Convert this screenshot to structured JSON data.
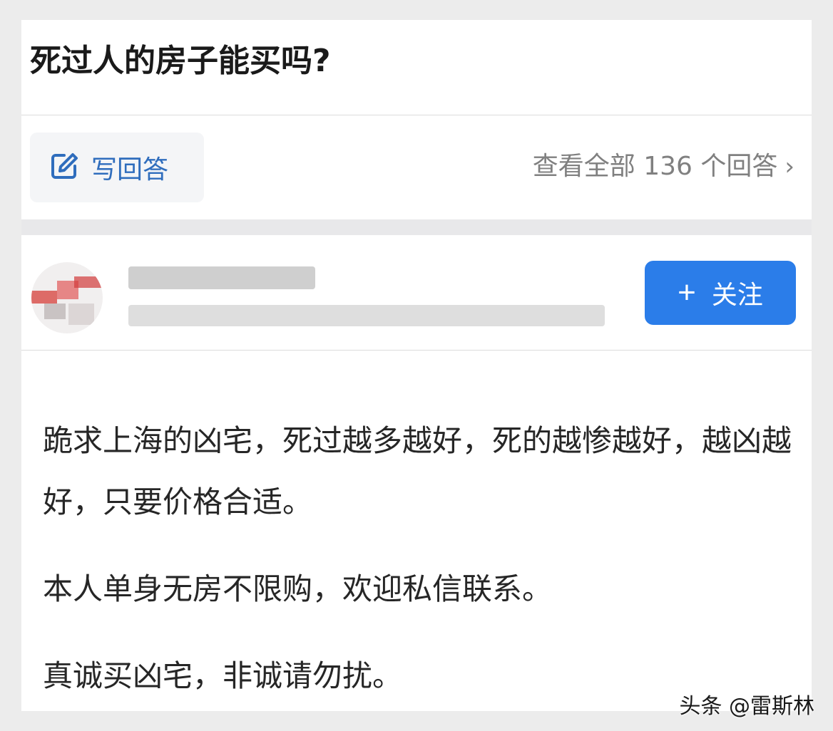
{
  "question": {
    "title": "死过人的房子能买吗?"
  },
  "actions": {
    "write_answer_label": "写回答",
    "view_all_label": "查看全部 136 个回答",
    "view_all_chevron": "›"
  },
  "author": {
    "follow_label": "关注",
    "follow_icon": "plus-icon"
  },
  "answer": {
    "paragraphs": [
      "跪求上海的凶宅，死过越多越好，死的越惨越好，越凶越好，只要价格合适。",
      "本人单身无房不限购，欢迎私信联系。",
      "真诚买凶宅，非诚请勿扰。"
    ]
  },
  "watermark": "头条 @雷斯林",
  "colors": {
    "accent": "#2b7de9",
    "link": "#2f6dbd"
  }
}
